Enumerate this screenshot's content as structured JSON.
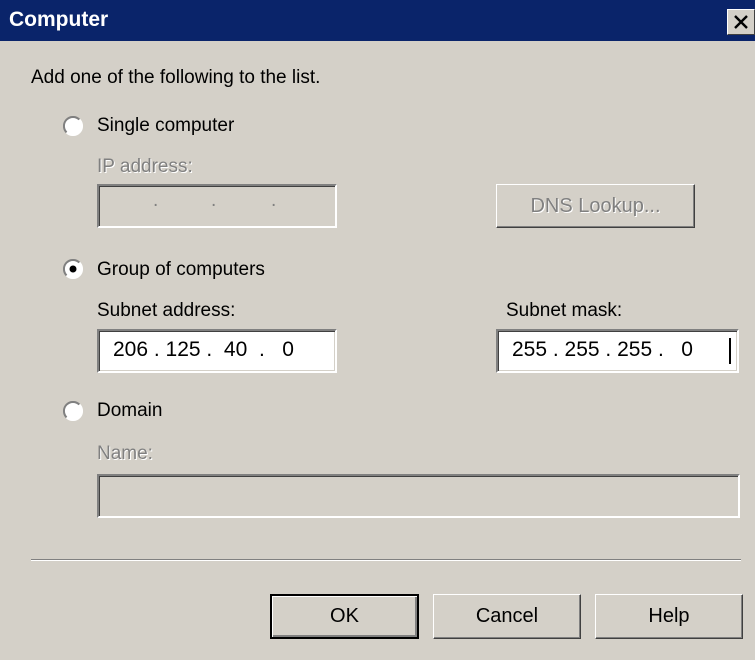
{
  "window": {
    "title": "Computer"
  },
  "intro": "Add one of the following to the list.",
  "single": {
    "label": "Single computer",
    "selected": false,
    "ip_label": "IP address:",
    "ip_value": "",
    "dns_button": "DNS Lookup..."
  },
  "group": {
    "label": "Group of computers",
    "selected": true,
    "subnet_address_label": "Subnet address:",
    "subnet_address_value": "206 . 125 .  40  .   0",
    "subnet_mask_label": "Subnet mask:",
    "subnet_mask_value": "255 . 255 . 255 .   0"
  },
  "domain": {
    "label": "Domain",
    "selected": false,
    "name_label": "Name:",
    "name_value": ""
  },
  "buttons": {
    "ok": "OK",
    "cancel": "Cancel",
    "help": "Help"
  },
  "icons": {
    "close": "close-icon",
    "radio": "radio-button-icon"
  }
}
